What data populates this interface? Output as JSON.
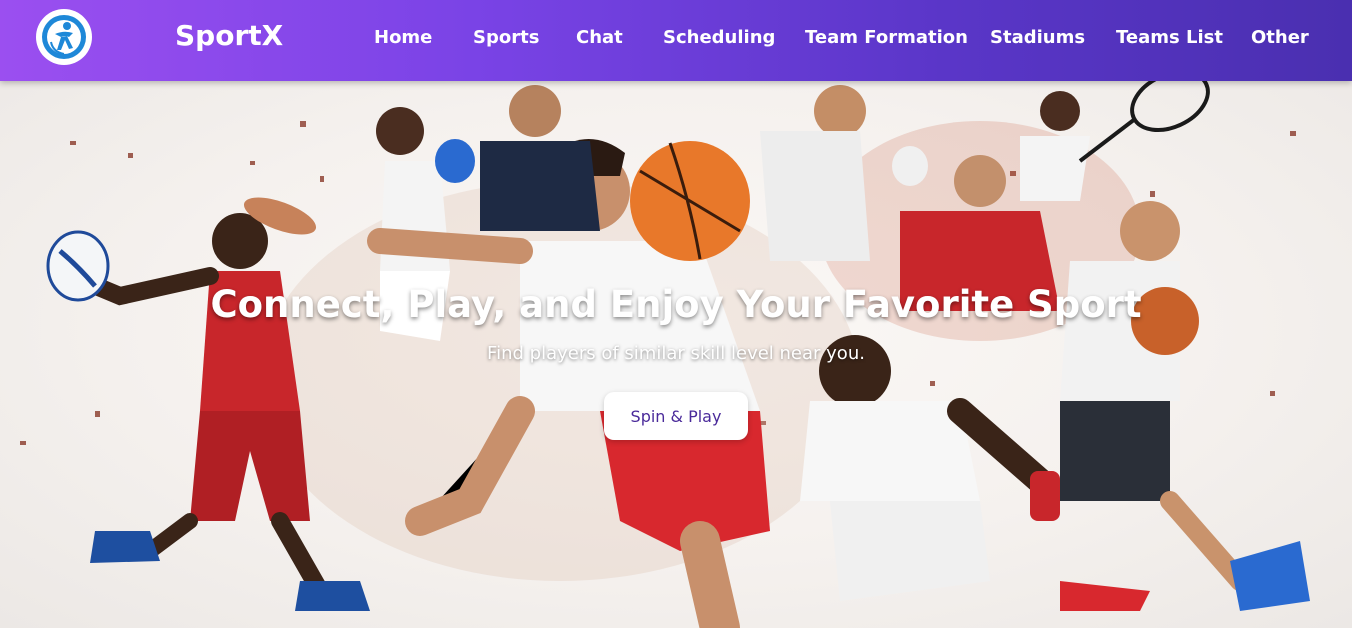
{
  "navbar": {
    "brand": "SportX",
    "logo_icon": "athlete-logo-icon",
    "links": [
      "Home",
      "Sports",
      "Chat",
      "Scheduling",
      "Team Formation",
      "Stadiums",
      "Teams List",
      "Other"
    ]
  },
  "hero": {
    "title": "Connect, Play, and Enjoy Your Favorite Sport",
    "subtitle": "Find players of similar skill level near you.",
    "cta_label": "Spin & Play"
  },
  "colors": {
    "nav_gradient_start": "#9b4ff0",
    "nav_gradient_end": "#4a2fb0",
    "cta_text": "#4a2a9a",
    "logo_accent": "#1e88d8"
  }
}
